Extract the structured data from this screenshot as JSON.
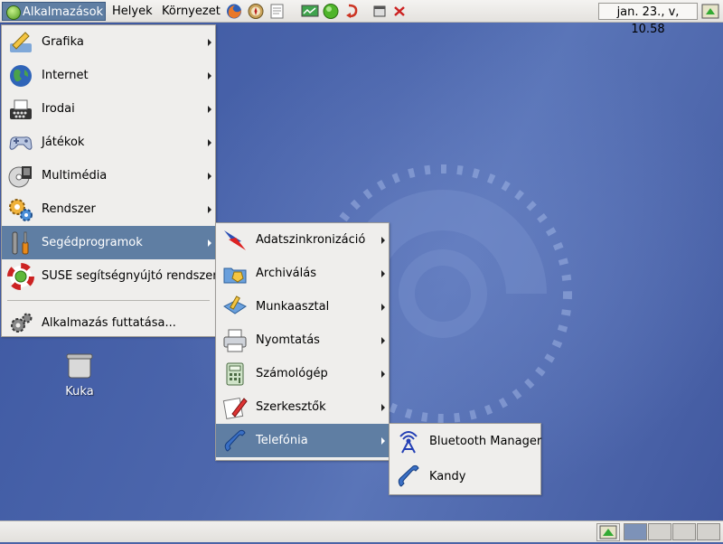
{
  "top_panel": {
    "applications_label": "Alkalmazások",
    "places_label": "Helyek",
    "system_label": "Környezet",
    "launchers": [
      "firefox-icon",
      "compass-icon",
      "document-icon",
      "monitor-icon",
      "green-orb-icon",
      "red-arrow-icon",
      "window-icon",
      "close-x-icon"
    ],
    "clock": "jan. 23., v, 10.58"
  },
  "main_menu": {
    "items": [
      {
        "label": "Grafika",
        "icon": "graphics-icon",
        "submenu": true
      },
      {
        "label": "Internet",
        "icon": "globe-icon",
        "submenu": true
      },
      {
        "label": "Irodai",
        "icon": "typewriter-icon",
        "submenu": true
      },
      {
        "label": "Játékok",
        "icon": "gamepad-icon",
        "submenu": true
      },
      {
        "label": "Multimédia",
        "icon": "multimedia-icon",
        "submenu": true
      },
      {
        "label": "Rendszer",
        "icon": "gears-icon",
        "submenu": true
      },
      {
        "label": "Segédprogramok",
        "icon": "tools-icon",
        "submenu": true,
        "highlighted": true
      },
      {
        "label": "SUSE segítségnyújtó rendszer",
        "icon": "lifebuoy-icon",
        "submenu": false
      }
    ],
    "run_label": "Alkalmazás futtatása..."
  },
  "utilities_menu": {
    "items": [
      {
        "label": "Adatszinkronizáció",
        "icon": "sync-icon"
      },
      {
        "label": "Archiválás",
        "icon": "archive-icon"
      },
      {
        "label": "Munkaasztal",
        "icon": "desktop-icon"
      },
      {
        "label": "Nyomtatás",
        "icon": "printer-icon"
      },
      {
        "label": "Számológép",
        "icon": "calculator-icon"
      },
      {
        "label": "Szerkesztők",
        "icon": "editor-icon"
      },
      {
        "label": "Telefónia",
        "icon": "phone-icon",
        "highlighted": true
      }
    ]
  },
  "telephony_menu": {
    "items": [
      {
        "label": "Bluetooth Manager",
        "icon": "bluetooth-icon"
      },
      {
        "label": "Kandy",
        "icon": "phone-icon"
      }
    ]
  },
  "desktop": {
    "trash_label": "Kuka"
  },
  "colors": {
    "highlight": "#5f7ea3",
    "desktop": "#4a63a6",
    "menu_bg": "#efeeec"
  }
}
